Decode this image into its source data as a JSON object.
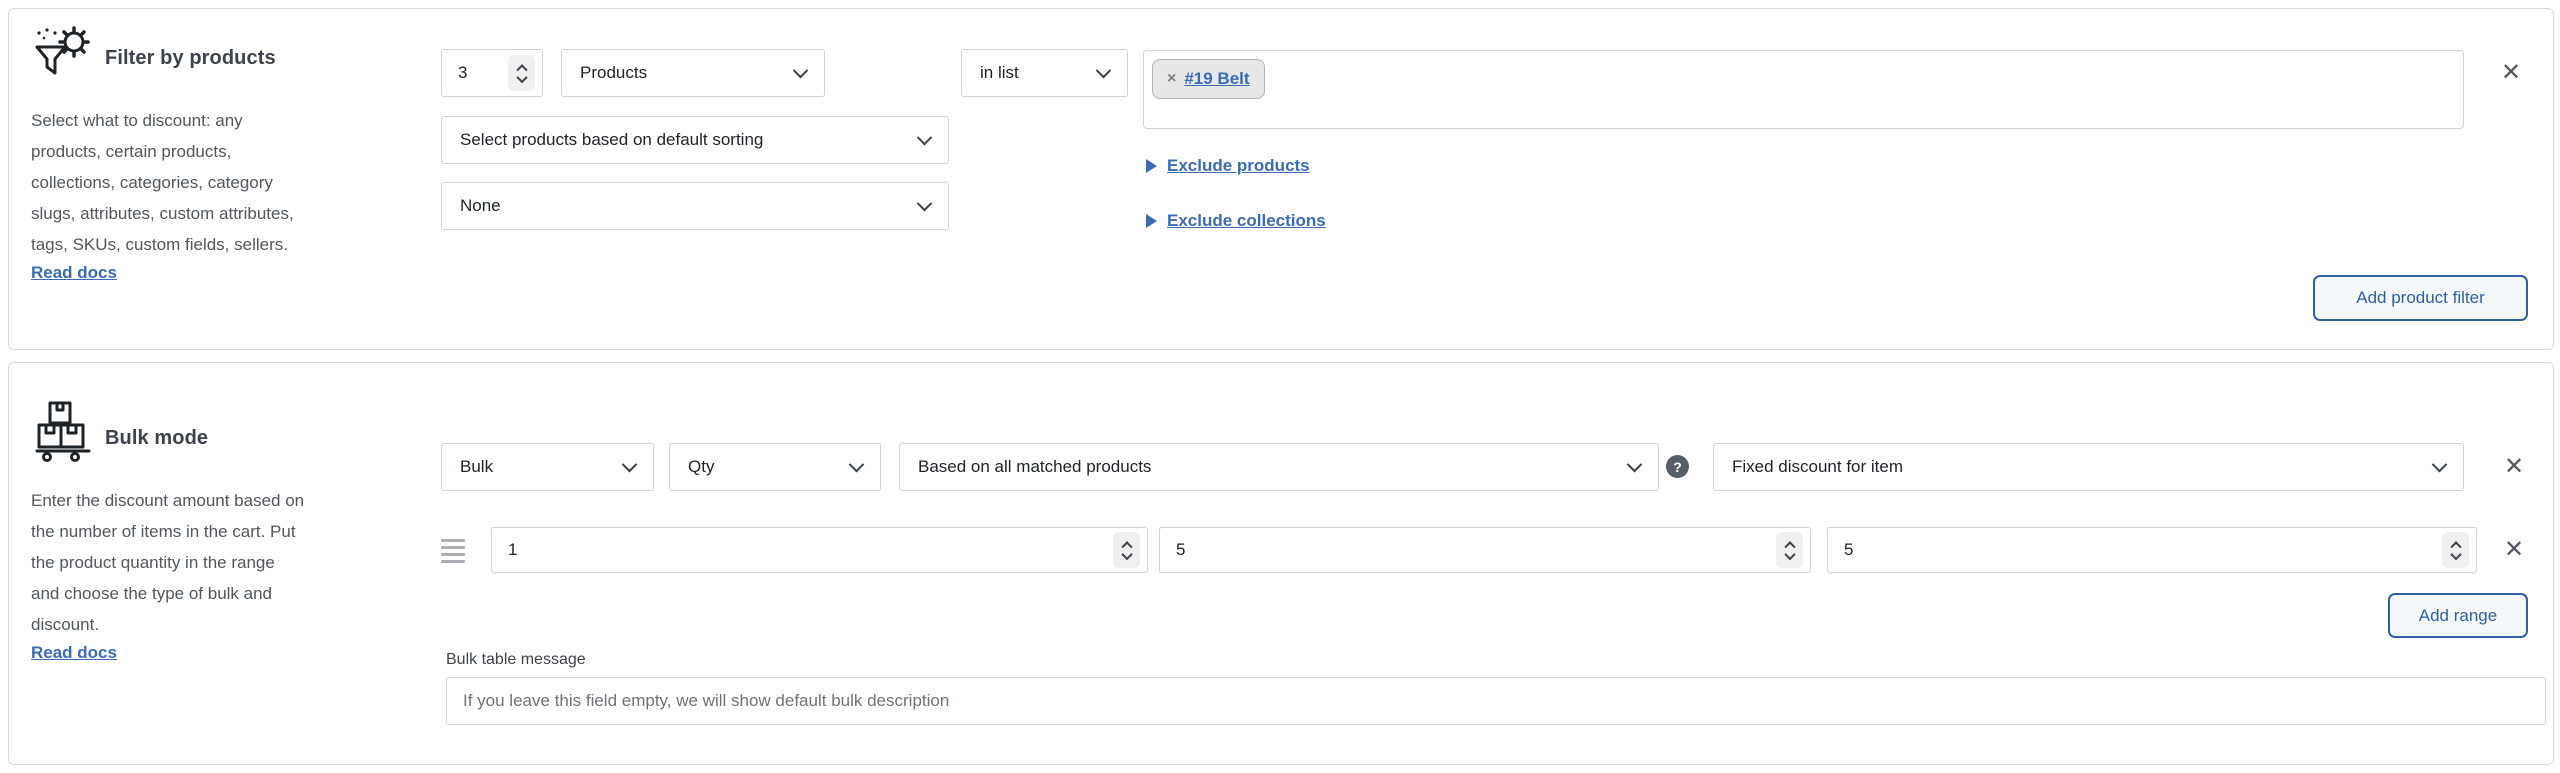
{
  "colors": {
    "link_blue": "#3a6bb5",
    "button_blue": "#2f5fa5",
    "panel_border": "#d8d9dd",
    "text_dark": "#1d2327",
    "text_gray": "#50575e"
  },
  "panels": {
    "filter": {
      "icon": "funnel-gear-icon",
      "title": "Filter by products",
      "desc_lines": [
        "Select what to discount: any",
        "products, certain products,",
        "collections, categories, category",
        "slugs, attributes, custom attributes,",
        "tags, SKUs, custom fields, sellers."
      ],
      "read_docs_label": "Read docs",
      "count_value": "3",
      "type_select_value": "Products",
      "sorting_select_value": "Select products based on default sorting",
      "secondary_select_value": "None",
      "operator_select_value": "in list",
      "tag": {
        "remove_glyph": "×",
        "label": "#19 Belt"
      },
      "exclude_products_label": "Exclude products",
      "exclude_collections_label": "Exclude collections",
      "add_button_label": "Add product filter",
      "close_glyph": "✕"
    },
    "bulk": {
      "icon": "boxes-cart-icon",
      "title": "Bulk mode",
      "desc_lines": [
        "Enter the discount amount based on",
        "the number of items in the cart. Put",
        "the product quantity in the range",
        "and choose the type of bulk and",
        "discount."
      ],
      "read_docs_label": "Read docs",
      "mode_select_value": "Bulk",
      "qty_select_value": "Qty",
      "based_on_select_value": "Based on all matched products",
      "help_glyph": "?",
      "discount_type_select_value": "Fixed discount for item",
      "range_row": {
        "qty_from": "1",
        "qty_to": "5",
        "discount_value": "5"
      },
      "add_range_label": "Add range",
      "message_label": "Bulk table message",
      "message_placeholder": "If you leave this field empty, we will show default bulk description",
      "close_glyph": "✕",
      "row_close_glyph": "✕"
    }
  }
}
